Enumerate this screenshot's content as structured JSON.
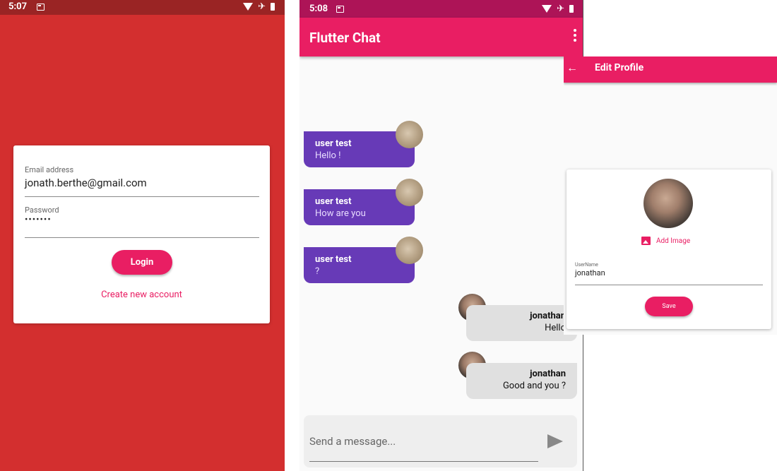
{
  "login_screen": {
    "status_time": "5:07",
    "email_label": "Email address",
    "email_value": "jonath.berthe@gmail.com",
    "password_label": "Password",
    "password_mask": "•••••••",
    "login_button": "Login",
    "create_account_link": "Create new account",
    "colors": {
      "background": "#d32f2f",
      "accent": "#e91e63"
    }
  },
  "chat_screen": {
    "status_time": "5:08",
    "title": "Flutter Chat",
    "messages": [
      {
        "name": "user test",
        "text": "Hello !",
        "side": "in"
      },
      {
        "name": "user test",
        "text": "How are you",
        "side": "in"
      },
      {
        "name": "user test",
        "text": "?",
        "side": "in"
      },
      {
        "name": "jonathan",
        "text": "Hello",
        "side": "out"
      },
      {
        "name": "jonathan",
        "text": "Good and you ?",
        "side": "out"
      }
    ],
    "composer_placeholder": "Send a message...",
    "colors": {
      "appbar": "#e91e63",
      "incoming_bubble": "#673ab7",
      "outgoing_bubble": "#e0e0e0"
    }
  },
  "edit_profile": {
    "title": "Edit Profile",
    "add_image": "Add Image",
    "username_label": "UserName",
    "username_value": "jonathan",
    "save_button": "Save"
  }
}
